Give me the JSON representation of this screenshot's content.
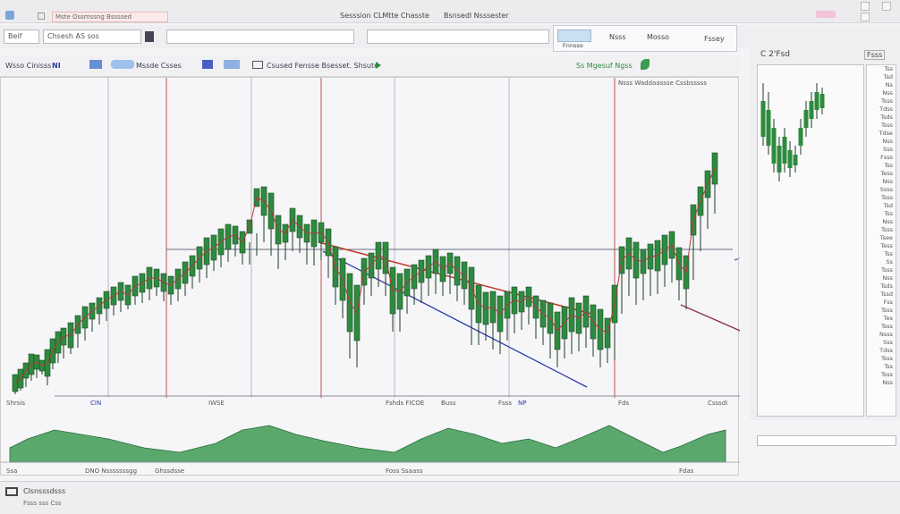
{
  "window": {
    "title_left": "Sesssion CLMtte Chasste",
    "title_right": "Bsnsedl Nsssester",
    "tab_label": "Mste Ossmssng Bssssed"
  },
  "toolbar": {
    "symbol_field": "Beif",
    "search_field": "Chsesh AS sos",
    "field_two": "",
    "field_three": "",
    "info_box_1": "Fnnsso",
    "info_box_2": "Nsss",
    "info_box_3": "Mosso",
    "info_box_4": "Fssey"
  },
  "toolbar2": {
    "label_1": "Wsso Cinisss",
    "label_2": "NI",
    "label_3": "Mssde Csses",
    "label_4": "Csused Fensse Bsesset. Shsute",
    "label_5": "Ss Mgesuf Ngss"
  },
  "chart": {
    "overlay_label": "Nsss Waddaassse Cssbsssss",
    "accent_green": "#2e8b3e",
    "accent_red": "#c0392b",
    "accent_blue": "#2b3aa8",
    "candles_bull": [
      [
        16,
        430,
        440,
        418,
        437
      ],
      [
        22,
        428,
        436,
        412,
        433
      ],
      [
        28,
        420,
        432,
        405,
        422
      ],
      [
        34,
        405,
        425,
        395,
        418
      ],
      [
        40,
        410,
        422,
        396,
        412
      ],
      [
        46,
        408,
        418,
        402,
        414
      ],
      [
        52,
        400,
        430,
        390,
        420
      ],
      [
        58,
        390,
        412,
        378,
        405
      ],
      [
        64,
        380,
        405,
        370,
        394
      ],
      [
        70,
        378,
        400,
        366,
        385
      ],
      [
        78,
        372,
        395,
        360,
        388
      ],
      [
        86,
        368,
        388,
        352,
        372
      ],
      [
        94,
        360,
        380,
        342,
        366
      ],
      [
        102,
        350,
        370,
        338,
        356
      ],
      [
        110,
        345,
        362,
        332,
        350
      ],
      [
        118,
        340,
        358,
        325,
        344
      ],
      [
        126,
        335,
        352,
        320,
        340
      ],
      [
        134,
        330,
        348,
        315,
        335
      ],
      [
        142,
        330,
        345,
        318,
        340
      ],
      [
        150,
        325,
        340,
        308,
        330
      ],
      [
        158,
        322,
        338,
        305,
        326
      ],
      [
        166,
        318,
        335,
        298,
        322
      ],
      [
        174,
        316,
        330,
        300,
        320
      ],
      [
        182,
        318,
        336,
        305,
        325
      ],
      [
        190,
        320,
        340,
        308,
        328
      ],
      [
        198,
        318,
        336,
        300,
        322
      ],
      [
        206,
        310,
        330,
        292,
        316
      ],
      [
        214,
        300,
        322,
        285,
        308
      ],
      [
        222,
        292,
        315,
        275,
        300
      ],
      [
        230,
        285,
        310,
        265,
        295
      ],
      [
        238,
        280,
        302,
        262,
        290
      ],
      [
        246,
        276,
        298,
        255,
        284
      ],
      [
        254,
        270,
        292,
        250,
        278
      ],
      [
        262,
        268,
        286,
        252,
        272
      ],
      [
        270,
        275,
        295,
        258,
        282
      ],
      [
        278,
        270,
        295,
        245,
        260
      ],
      [
        286,
        260,
        285,
        210,
        230
      ],
      [
        294,
        220,
        270,
        208,
        240
      ],
      [
        302,
        235,
        285,
        215,
        255
      ],
      [
        310,
        260,
        300,
        240,
        272
      ],
      [
        318,
        262,
        290,
        250,
        270
      ],
      [
        326,
        240,
        280,
        232,
        258
      ],
      [
        334,
        250,
        282,
        240,
        265
      ],
      [
        342,
        256,
        295,
        250,
        270
      ],
      [
        350,
        260,
        296,
        245,
        275
      ],
      [
        358,
        262,
        290,
        248,
        270
      ],
      [
        366,
        268,
        310,
        255,
        285
      ],
      [
        374,
        290,
        340,
        275,
        320
      ],
      [
        382,
        300,
        355,
        288,
        335
      ],
      [
        390,
        320,
        400,
        305,
        370
      ],
      [
        398,
        330,
        410,
        318,
        380
      ],
      [
        406,
        300,
        340,
        288,
        318
      ],
      [
        414,
        295,
        330,
        282,
        310
      ],
      [
        422,
        280,
        320,
        270,
        300
      ],
      [
        430,
        278,
        330,
        270,
        305
      ],
      [
        438,
        310,
        370,
        298,
        350
      ],
      [
        446,
        318,
        370,
        305,
        345
      ],
      [
        454,
        315,
        350,
        300,
        330
      ],
      [
        462,
        305,
        340,
        295,
        322
      ],
      [
        470,
        300,
        338,
        290,
        315
      ],
      [
        478,
        295,
        330,
        285,
        310
      ],
      [
        486,
        290,
        328,
        278,
        305
      ],
      [
        494,
        298,
        330,
        286,
        314
      ],
      [
        502,
        290,
        328,
        282,
        305
      ],
      [
        510,
        295,
        336,
        286,
        318
      ],
      [
        518,
        300,
        340,
        292,
        322
      ],
      [
        526,
        310,
        385,
        298,
        345
      ],
      [
        534,
        330,
        385,
        318,
        360
      ],
      [
        542,
        340,
        380,
        326,
        362
      ],
      [
        550,
        336,
        390,
        325,
        360
      ],
      [
        558,
        342,
        395,
        330,
        370
      ],
      [
        566,
        338,
        380,
        325,
        355
      ],
      [
        574,
        334,
        372,
        320,
        350
      ],
      [
        582,
        336,
        368,
        325,
        348
      ],
      [
        590,
        332,
        362,
        320,
        342
      ],
      [
        598,
        340,
        378,
        330,
        355
      ],
      [
        606,
        345,
        385,
        335,
        365
      ],
      [
        614,
        350,
        400,
        338,
        372
      ],
      [
        622,
        360,
        410,
        348,
        390
      ],
      [
        630,
        355,
        400,
        342,
        378
      ],
      [
        638,
        345,
        395,
        332,
        370
      ],
      [
        646,
        350,
        392,
        338,
        372
      ],
      [
        654,
        345,
        388,
        330,
        365
      ],
      [
        662,
        352,
        398,
        340,
        378
      ],
      [
        670,
        360,
        410,
        345,
        390
      ],
      [
        678,
        370,
        405,
        355,
        388
      ],
      [
        686,
        330,
        402,
        318,
        360
      ],
      [
        694,
        290,
        350,
        275,
        305
      ],
      [
        702,
        280,
        330,
        265,
        300
      ],
      [
        710,
        285,
        340,
        270,
        310
      ],
      [
        718,
        290,
        335,
        278,
        305
      ],
      [
        726,
        285,
        330,
        272,
        300
      ],
      [
        734,
        280,
        328,
        268,
        302
      ],
      [
        742,
        275,
        320,
        262,
        295
      ],
      [
        750,
        270,
        315,
        258,
        288
      ],
      [
        758,
        290,
        335,
        276,
        312
      ],
      [
        766,
        300,
        345,
        285,
        322
      ],
      [
        774,
        240,
        312,
        228,
        262
      ],
      [
        782,
        220,
        280,
        208,
        240
      ],
      [
        790,
        200,
        255,
        190,
        220
      ],
      [
        798,
        180,
        238,
        170,
        205
      ]
    ],
    "indicator_label_1": "Shrsis",
    "indicator_label_2": "CIN",
    "indicator_label_3": "IWSE",
    "indicator_label_4": "Fshds FICOE",
    "indicator_label_5": "Buss",
    "indicator_label_6": "Fsss",
    "indicator_label_7": "Fds",
    "indicator_label_8": "NP",
    "indicator_label_9": "Csssdi"
  },
  "bottom_axis": {
    "label_1": "Ssa",
    "label_2": "DNO Nsssssssgg",
    "label_3": "Ghssdsse",
    "label_4": "Foss Ssaass",
    "label_5": "Fdas"
  },
  "right_panel": {
    "title": "C 2'Fsd",
    "corner_label": "Fsss",
    "side_items": [
      "Tss",
      "Tsd",
      "Ns",
      "Nss",
      "Tsss",
      "Tdss",
      "Tsds",
      "Tsss",
      "Tdse",
      "Nss",
      "Sss",
      "Fsss",
      "Tss",
      "Tess",
      "Nss",
      "Ssss",
      "Tsss",
      "Tsd",
      "Tss",
      "Nss",
      "Tsss",
      "Tsee",
      "Tess",
      "Tss",
      "Ss",
      "Tsss",
      "Nss",
      "Tsds",
      "Tssd",
      "Fss",
      "Tsss",
      "Tes",
      "Tsss",
      "Nsss",
      "Sss",
      "Tdss",
      "Tsss",
      "Tss",
      "Tsss",
      "Nss"
    ]
  },
  "status": {
    "label": "Clsnsssdsss",
    "sub_label": "Fsss sss Css"
  }
}
